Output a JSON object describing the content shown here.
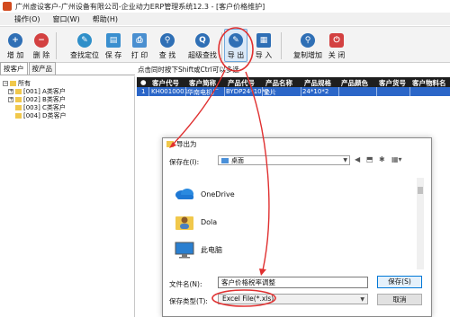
{
  "window": {
    "title": "广州虚设客户-广州设备有限公司-企业动力ERP管理系统12.3 - [客户价格维护]"
  },
  "menu": {
    "items": [
      "操作(O)",
      "窗口(W)",
      "帮助(H)"
    ]
  },
  "toolbar": {
    "buttons": [
      {
        "label": "增 加",
        "icon": "plus-icon",
        "color": "#2f6fb5",
        "glyph": "+"
      },
      {
        "label": "删 除",
        "icon": "delete-icon",
        "color": "#d34141",
        "glyph": "−"
      },
      {
        "label": "查找定位",
        "icon": "locate-icon",
        "color": "#2f8fc9",
        "glyph": "✎"
      },
      {
        "label": "保 存",
        "icon": "save-icon",
        "color": "#3a8fcf",
        "glyph": "▤"
      },
      {
        "label": "打 印",
        "icon": "print-icon",
        "color": "#4a8fd0",
        "glyph": "⎙"
      },
      {
        "label": "查 找",
        "icon": "search-icon",
        "color": "#2f6fb5",
        "glyph": "⚲"
      },
      {
        "label": "超级查找",
        "icon": "advanced-search-icon",
        "color": "#2f6fb5",
        "glyph": "Q"
      },
      {
        "label": "导 出",
        "icon": "export-icon",
        "color": "#2f6fb5",
        "glyph": "✎"
      },
      {
        "label": "导 入",
        "icon": "import-icon",
        "color": "#2f6fb5",
        "glyph": "▦"
      },
      {
        "label": "复制增加",
        "icon": "copy-add-icon",
        "color": "#2f6fb5",
        "glyph": "⚲"
      },
      {
        "label": "关 闭",
        "icon": "close-icon",
        "color": "#d34141",
        "glyph": "⏻"
      }
    ]
  },
  "left_tabs": [
    "按客户",
    "按产品"
  ],
  "tree": {
    "root": "所有",
    "children": [
      "[001] A类客户",
      "[002] B类客户",
      "[003] C类客户",
      "[004] D类客户"
    ]
  },
  "hint": "点击同时按下Shift或Ctrl可以多选",
  "grid": {
    "headers": [
      "●",
      "客户代号",
      "客户简称",
      "产品代号",
      "产品名称",
      "产品规格",
      "产品颜色",
      "客户货号",
      "客户物料名"
    ],
    "rows": [
      [
        "1",
        "KH0010001",
        "华南电机厂",
        "BYDP24*10*2",
        "垫片",
        "24*10*2",
        "",
        "",
        ""
      ]
    ]
  },
  "dialog": {
    "title": "导出为",
    "location_label": "保存在(I):",
    "location_value": "桌面",
    "files": [
      {
        "name": "OneDrive",
        "icon": "onedrive-icon"
      },
      {
        "name": "Dola",
        "icon": "user-folder-icon"
      },
      {
        "name": "此电脑",
        "icon": "computer-icon"
      }
    ],
    "filename_label": "文件名(N):",
    "filename_value": "客户价格税率调整",
    "filetype_label": "保存类型(T):",
    "filetype_value": "Excel File(*.xls)",
    "save_label": "保存(S)",
    "cancel_label": "取消"
  },
  "annotation_color": "#e03030"
}
